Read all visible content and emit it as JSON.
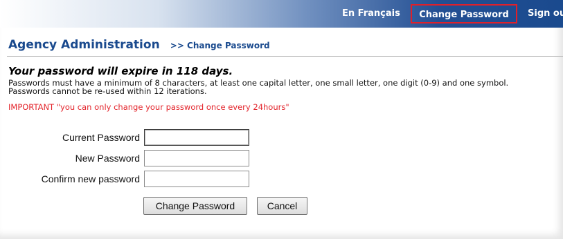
{
  "nav": {
    "french": "En Français",
    "change_password": "Change Password",
    "sign_out": "Sign ou"
  },
  "header": {
    "title": "Agency Administration",
    "breadcrumb": ">> Change Password"
  },
  "messages": {
    "expiry": "Your password will expire in 118 days.",
    "rules_line1": "Passwords must have a minimum of 8 characters, at least one capital letter, one small letter, one digit (0-9) and one symbol.",
    "rules_line2": "Passwords cannot be re-used within 12 iterations.",
    "important": "IMPORTANT \"you can only change your password once every 24hours\""
  },
  "form": {
    "current_label": "Current Password",
    "current_value": "",
    "new_label": "New Password",
    "new_value": "",
    "confirm_label": "Confirm new password",
    "confirm_value": "",
    "submit_label": "Change Password",
    "cancel_label": "Cancel"
  },
  "colors": {
    "nav_blue": "#1a4a8e",
    "highlight_border": "#e0202a",
    "important_red": "#e3242b"
  }
}
